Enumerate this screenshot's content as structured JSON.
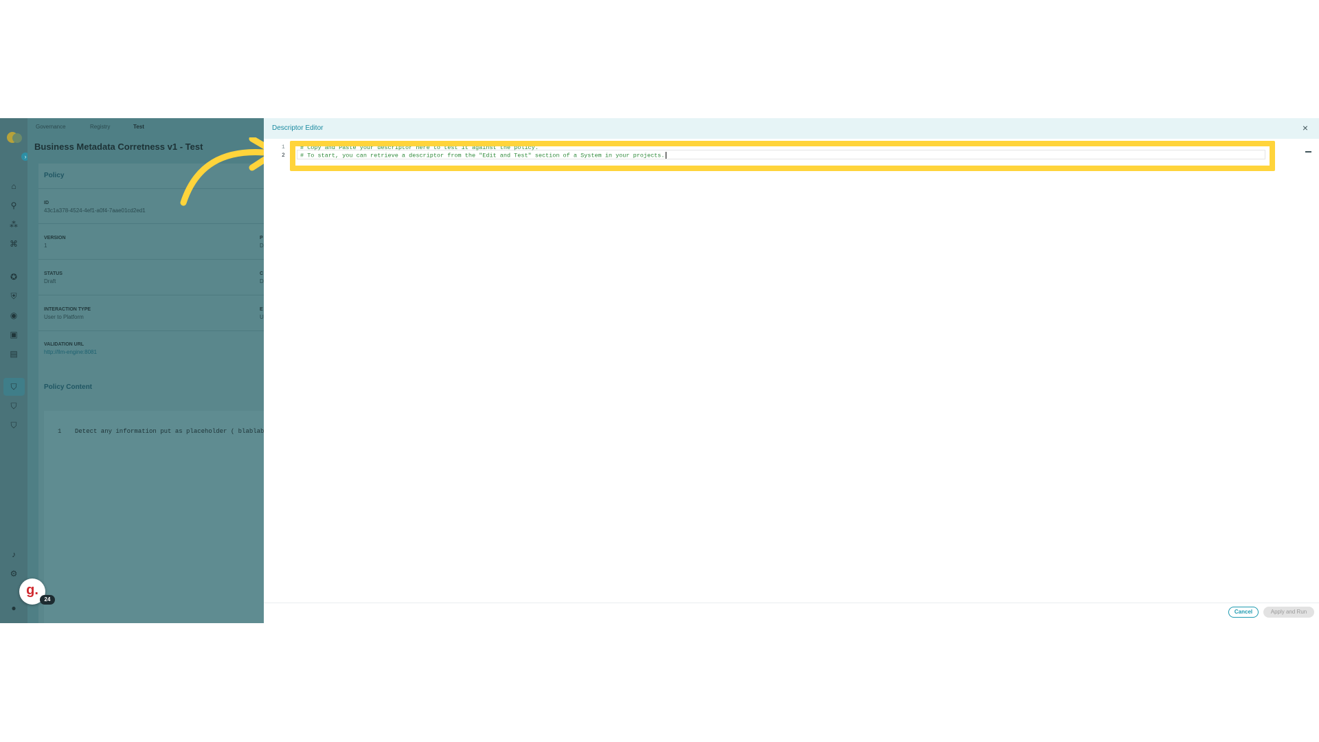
{
  "breadcrumb": [
    "Governance",
    "Registry",
    "Test"
  ],
  "page": {
    "title": "Business Metadata Corretness v1 - Test"
  },
  "policy_card": {
    "heading": "Policy",
    "fields": [
      {
        "label": "ID",
        "value": "43c1a378-4524-4ef1-a0f4-7aae01cd2ed1"
      },
      {
        "label": "VERSION",
        "value": "1"
      },
      {
        "label": "STATUS",
        "value": "Draft"
      },
      {
        "label": "INTERACTION TYPE",
        "value": "User to Platform"
      },
      {
        "label": "VALIDATION URL",
        "value": "http://llm-engine:8081"
      }
    ],
    "right_col_fragments": [
      "P",
      "D",
      "C",
      "D",
      "E",
      "U"
    ]
  },
  "policy_content": {
    "heading": "Policy Content",
    "line_number": "1",
    "text": "Detect any information put as placeholder ( blablab"
  },
  "sidebar": {
    "expand_glyph": "›",
    "icons": [
      "home-icon",
      "search-icon",
      "graph-icon",
      "hierarchy-icon",
      "compass-icon",
      "shield-icon",
      "target-icon",
      "box-icon",
      "table-icon",
      "policy-shield-icon",
      "policy-shield-2-icon",
      "policy-shield-3-icon",
      "bell-icon",
      "gear-icon",
      "user-icon"
    ]
  },
  "avatar": {
    "letter": "g.",
    "badge": "24"
  },
  "modal": {
    "title": "Descriptor Editor",
    "close_glyph": "×",
    "editor": {
      "lines": [
        {
          "number": "1",
          "text": "# Copy and Paste your descriptor here to test it against the policy."
        },
        {
          "number": "2",
          "text": "# To start, you can retrieve a descriptor from the \"Edit and Test\" section of a System in your projects."
        }
      ]
    },
    "buttons": {
      "cancel": "Cancel",
      "apply": "Apply and Run"
    }
  },
  "colors": {
    "highlight": "#ffd43b",
    "accent": "#1d9ab0",
    "overlay": "#4f7f85"
  }
}
